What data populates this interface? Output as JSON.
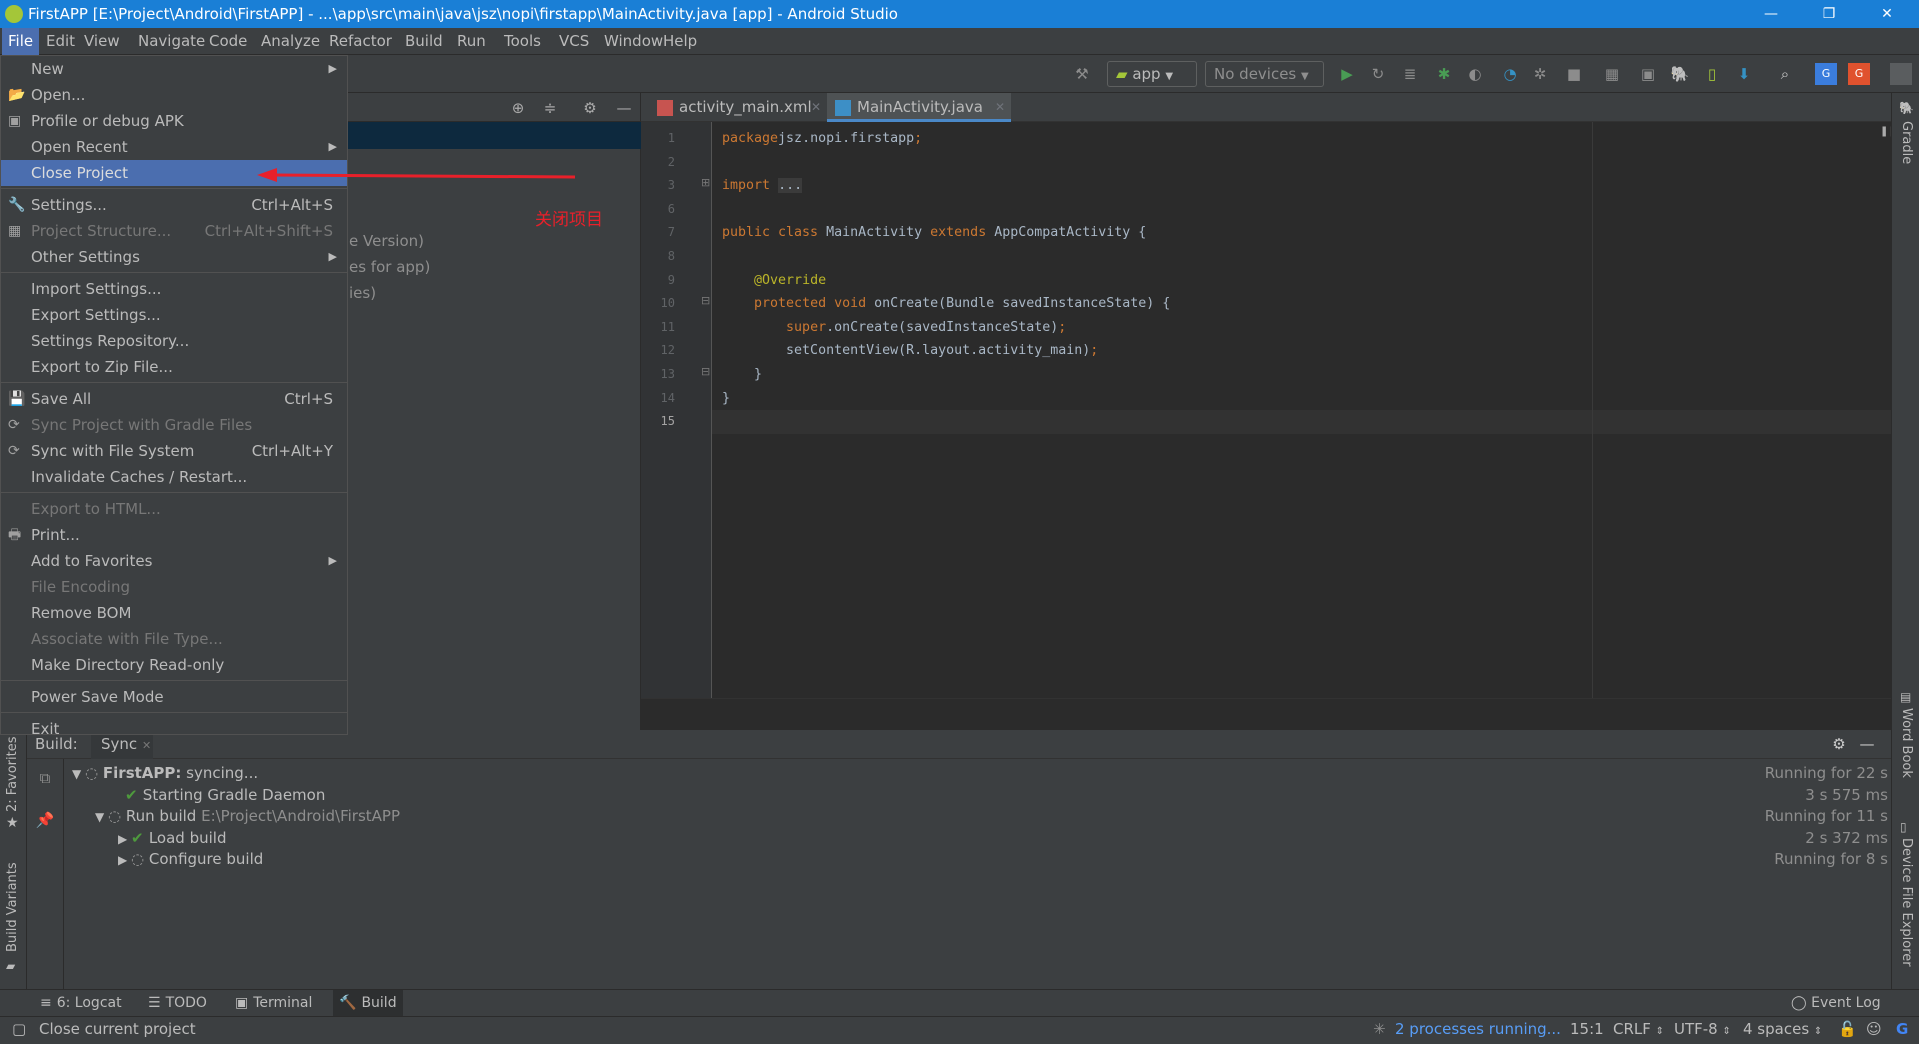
{
  "window": {
    "title": "FirstAPP [E:\\Project\\Android\\FirstAPP] - ...\\app\\src\\main\\java\\jsz\\nopi\\firstapp\\MainActivity.java [app] - Android Studio",
    "minimize": "—",
    "restore": "❐",
    "close": "✕"
  },
  "menubar": [
    "File",
    "Edit",
    "View",
    "Navigate",
    "Code",
    "Analyze",
    "Refactor",
    "Build",
    "Run",
    "Tools",
    "VCS",
    "Window",
    "Help"
  ],
  "toolbar": {
    "config": "app",
    "device": "No devices"
  },
  "file_menu": [
    {
      "label": "New",
      "submenu": true
    },
    {
      "label": "Open...",
      "icon": "📂"
    },
    {
      "label": "Profile or debug APK",
      "icon": "▣"
    },
    {
      "label": "Open Recent",
      "submenu": true
    },
    {
      "label": "Close Project",
      "highlighted": true
    },
    {
      "sep": true
    },
    {
      "label": "Settings...",
      "shortcut": "Ctrl+Alt+S",
      "icon": "🔧"
    },
    {
      "label": "Project Structure...",
      "shortcut": "Ctrl+Alt+Shift+S",
      "disabled": true,
      "icon": "▦"
    },
    {
      "label": "Other Settings",
      "submenu": true
    },
    {
      "sep": true
    },
    {
      "label": "Import Settings..."
    },
    {
      "label": "Export Settings..."
    },
    {
      "label": "Settings Repository..."
    },
    {
      "label": "Export to Zip File..."
    },
    {
      "sep": true
    },
    {
      "label": "Save All",
      "shortcut": "Ctrl+S",
      "icon": "💾"
    },
    {
      "label": "Sync Project with Gradle Files",
      "disabled": true,
      "icon": "⟳"
    },
    {
      "label": "Sync with File System",
      "shortcut": "Ctrl+Alt+Y",
      "icon": "⟳"
    },
    {
      "label": "Invalidate Caches / Restart..."
    },
    {
      "sep": true
    },
    {
      "label": "Export to HTML...",
      "disabled": true
    },
    {
      "label": "Print...",
      "icon": "🖶"
    },
    {
      "label": "Add to Favorites",
      "submenu": true
    },
    {
      "label": "File Encoding",
      "disabled": true
    },
    {
      "label": "Remove BOM"
    },
    {
      "label": "Associate with File Type...",
      "disabled": true
    },
    {
      "label": "Make Directory Read-only"
    },
    {
      "sep": true
    },
    {
      "label": "Power Save Mode"
    },
    {
      "sep": true
    },
    {
      "label": "Exit"
    }
  ],
  "annotation": {
    "text": "关闭项目",
    "color": "#e8202a"
  },
  "project_panel": {
    "partial_items": [
      "e Version)",
      "es for app)",
      "ies)"
    ]
  },
  "editor": {
    "tabs": [
      {
        "label": "activity_main.xml",
        "active": false
      },
      {
        "label": "MainActivity.java",
        "active": true
      }
    ],
    "current_line": "15",
    "lines": [
      {
        "n": "1",
        "tokens": [
          [
            "kw",
            "package"
          ],
          [
            "",
            "jsz.nopi.firstapp"
          ],
          [
            "kw",
            ";"
          ]
        ]
      },
      {
        "n": "2",
        "tokens": []
      },
      {
        "n": "3",
        "tokens": [
          [
            "kw",
            "import"
          ],
          [
            "",
            " "
          ],
          [
            "fold",
            "..."
          ]
        ]
      },
      {
        "n": "6",
        "tokens": []
      },
      {
        "n": "7",
        "tokens": [
          [
            "kw",
            "public class"
          ],
          [
            "",
            " MainActivity "
          ],
          [
            "kw",
            "extends"
          ],
          [
            "",
            " AppCompatActivity {"
          ]
        ]
      },
      {
        "n": "8",
        "tokens": []
      },
      {
        "n": "9",
        "tokens": [
          [
            "",
            "    "
          ],
          [
            "an",
            "@Override"
          ]
        ]
      },
      {
        "n": "10",
        "tokens": [
          [
            "",
            "    "
          ],
          [
            "kw",
            "protected void"
          ],
          [
            "",
            " onCreate(Bundle savedInstanceState) {"
          ]
        ]
      },
      {
        "n": "11",
        "tokens": [
          [
            "",
            "        "
          ],
          [
            "kw",
            "super"
          ],
          [
            "",
            ".onCreate(savedInstanceState)"
          ],
          [
            "kw",
            ";"
          ]
        ]
      },
      {
        "n": "12",
        "tokens": [
          [
            "",
            "        setContentView(R.layout.activity_main)"
          ],
          [
            "kw",
            ";"
          ]
        ]
      },
      {
        "n": "13",
        "tokens": [
          [
            "",
            "    }"
          ]
        ]
      },
      {
        "n": "14",
        "tokens": [
          [
            "",
            "}"
          ]
        ]
      },
      {
        "n": "15",
        "tokens": []
      }
    ]
  },
  "build": {
    "label": "Build:",
    "tab": "Sync",
    "tree": [
      {
        "indent": 0,
        "arrow": "▼",
        "status": "spin",
        "bold": "FirstAPP:",
        "text": " syncing...",
        "right": "Running for 22 s"
      },
      {
        "indent": 1,
        "arrow": "",
        "status": "ok",
        "text": "Starting Gradle Daemon",
        "right": "3 s 575 ms"
      },
      {
        "indent": 1,
        "arrow": "▼",
        "status": "spin",
        "text": "Run build",
        "path": " E:\\Project\\Android\\FirstAPP",
        "right": "Running for 11 s"
      },
      {
        "indent": 2,
        "arrow": "▶",
        "status": "ok",
        "text": "Load build",
        "right": "2 s 372 ms"
      },
      {
        "indent": 2,
        "arrow": "▶",
        "status": "spin",
        "text": "Configure build",
        "right": "Running for 8 s"
      }
    ]
  },
  "left_stripe": [
    "2: Favorites",
    "Build Variants"
  ],
  "right_stripe": [
    "Gradle",
    "Word Book",
    "Device File Explorer"
  ],
  "bottom_tools": [
    {
      "label": "6: Logcat",
      "icon": "≡"
    },
    {
      "label": "TODO",
      "icon": "☰"
    },
    {
      "label": "Terminal",
      "icon": "▣"
    },
    {
      "label": "Build",
      "icon": "🔨",
      "active": true
    }
  ],
  "event_log": "Event Log",
  "status": {
    "message": "Close current project",
    "processes": "2 processes running...",
    "position": "15:1",
    "line_sep": "CRLF",
    "encoding": "UTF-8",
    "indent": "4 spaces"
  },
  "colors": {
    "accent": "#4b6eaf",
    "titlebar": "#1a7fd6",
    "keyword": "#cc7832",
    "link": "#589df6"
  }
}
